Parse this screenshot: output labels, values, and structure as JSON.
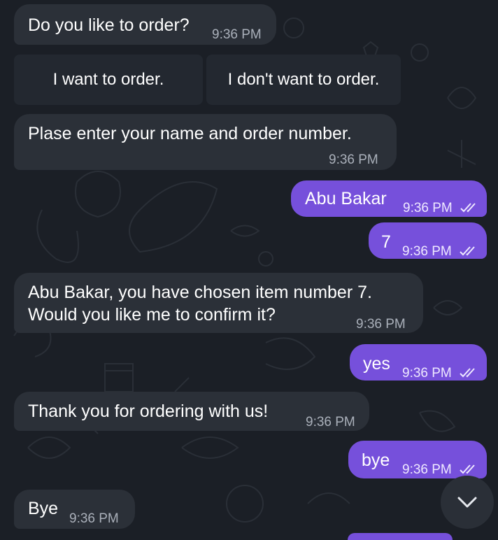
{
  "messages": [
    {
      "text": "Do you like to order?",
      "time": "9:36 PM"
    },
    {
      "text": "Plase enter your name and order number.",
      "time": "9:36 PM"
    },
    {
      "text": "Abu Bakar",
      "time": "9:36 PM"
    },
    {
      "text": "7",
      "time": "9:36 PM"
    },
    {
      "line1": "Abu Bakar, you have chosen item number 7.",
      "line2": "Would you like me to confirm it?",
      "time": "9:36 PM"
    },
    {
      "text": "yes",
      "time": "9:36 PM"
    },
    {
      "text": "Thank you for ordering with us!",
      "time": "9:36 PM"
    },
    {
      "text": "bye",
      "time": "9:36 PM"
    },
    {
      "text": "Bye",
      "time": "9:36 PM"
    }
  ],
  "keyboard": {
    "order_button": "I want to order.",
    "no_order_button": "I don't want to order."
  },
  "icons": {
    "scroll_down": "chevron-down-icon",
    "read_receipt": "double-check-icon"
  },
  "colors": {
    "background": "#1b1f26",
    "incoming_bubble": "#2b3038",
    "outgoing_bubble": "#7650db",
    "keyboard_button": "#232830"
  }
}
